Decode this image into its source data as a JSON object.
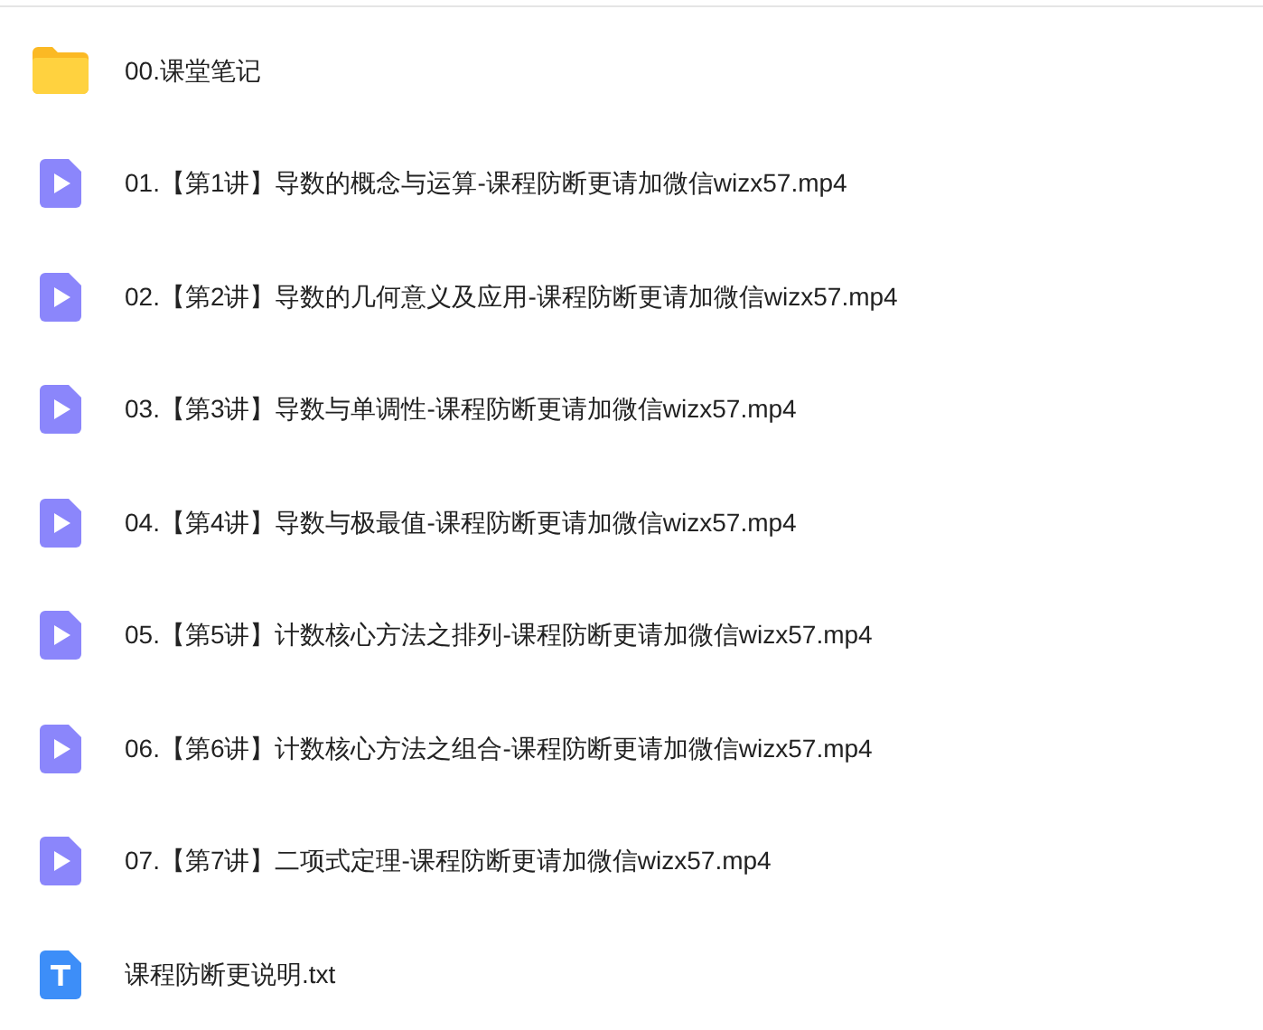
{
  "files": [
    {
      "kind": "folder",
      "name": "00.课堂笔记"
    },
    {
      "kind": "video",
      "name": "01.【第1讲】导数的概念与运算-课程防断更请加微信wizx57.mp4"
    },
    {
      "kind": "video",
      "name": "02.【第2讲】导数的几何意义及应用-课程防断更请加微信wizx57.mp4"
    },
    {
      "kind": "video",
      "name": "03.【第3讲】导数与单调性-课程防断更请加微信wizx57.mp4"
    },
    {
      "kind": "video",
      "name": "04.【第4讲】导数与极最值-课程防断更请加微信wizx57.mp4"
    },
    {
      "kind": "video",
      "name": "05.【第5讲】计数核心方法之排列-课程防断更请加微信wizx57.mp4"
    },
    {
      "kind": "video",
      "name": "06.【第6讲】计数核心方法之组合-课程防断更请加微信wizx57.mp4"
    },
    {
      "kind": "video",
      "name": "07.【第7讲】二项式定理-课程防断更请加微信wizx57.mp4"
    },
    {
      "kind": "text",
      "name": "课程防断更说明.txt"
    }
  ]
}
